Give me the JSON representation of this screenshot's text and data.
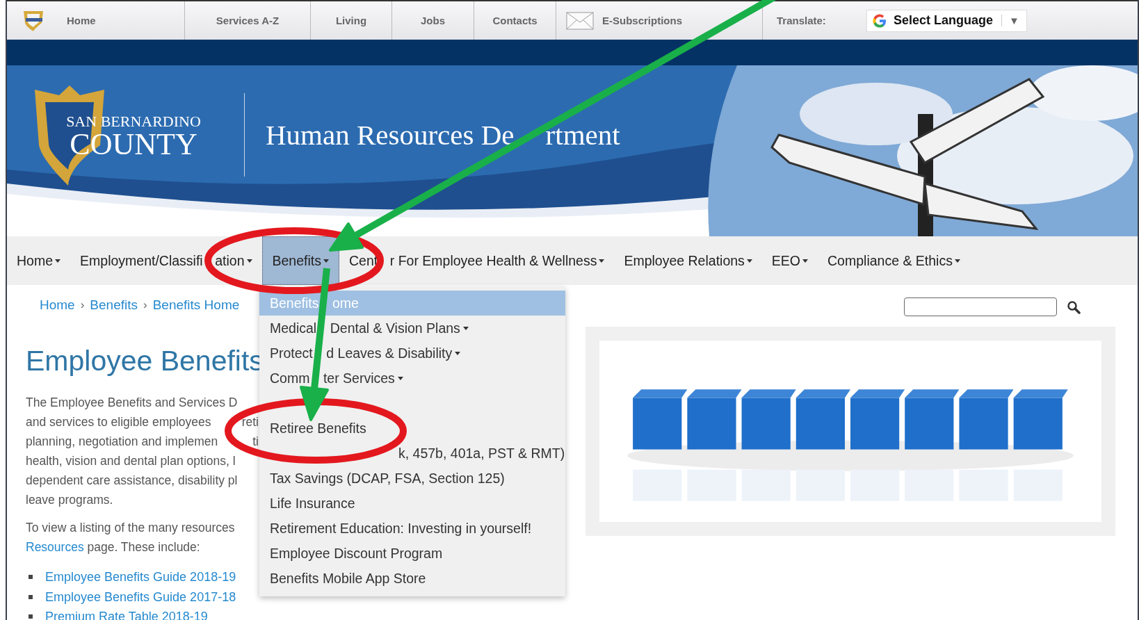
{
  "top_bar": {
    "links": [
      "Home",
      "Services A-Z",
      "Living",
      "Jobs",
      "Contacts"
    ],
    "subscriptions": "E-Subscriptions",
    "translate_label": "Translate:",
    "language_select": "Select Language",
    "select_arrow": "▼"
  },
  "banner": {
    "logo_line1": "SAN BERNARDINO",
    "logo_line2": "COUNTY",
    "title_parts": [
      "Human Resources De",
      "rtment"
    ]
  },
  "main_nav": [
    {
      "label_parts": [
        "Home"
      ],
      "selected": false
    },
    {
      "label_parts": [
        "Employment/Classifi",
        "ation"
      ],
      "selected": false
    },
    {
      "label_parts": [
        "Benefits"
      ],
      "selected": true
    },
    {
      "label_parts": [
        "Cent",
        "r For Employee Health & Wellness"
      ],
      "selected": false
    },
    {
      "label_parts": [
        "Employee Relations"
      ],
      "selected": false
    },
    {
      "label_parts": [
        "EEO"
      ],
      "selected": false
    },
    {
      "label_parts": [
        "Compliance & Ethics"
      ],
      "selected": false
    }
  ],
  "breadcrumb": {
    "items": [
      "Home",
      "Benefits",
      "Benefits Home"
    ],
    "separator": "›"
  },
  "dropdown": [
    {
      "label_parts": [
        "Benefits",
        "ome"
      ],
      "selected": true,
      "submenu": false
    },
    {
      "label_parts": [
        "Medical",
        "Dental & Vision Plans"
      ],
      "selected": false,
      "submenu": true
    },
    {
      "label_parts": [
        "Protect",
        "d Leaves & Disability"
      ],
      "selected": false,
      "submenu": true
    },
    {
      "label_parts": [
        "Comm",
        "ter Services"
      ],
      "selected": false,
      "submenu": true
    },
    {
      "selected": false,
      "submenu": false
    },
    {
      "label_parts": [
        "Retiree Benefits"
      ],
      "selected": false,
      "submenu": false
    },
    {
      "label_parts": [
        "k, 457b, 401a, PST & RMT)"
      ],
      "selected": false,
      "submenu": false,
      "kind": "start_hidden"
    },
    {
      "label_parts": [
        "Tax Savings (DCAP, FSA, Section 125)"
      ],
      "selected": false,
      "submenu": false
    },
    {
      "label_parts": [
        "Life Insurance"
      ],
      "selected": false,
      "submenu": false
    },
    {
      "label_parts": [
        "Retirement Education: Investing in yourself!"
      ],
      "selected": false,
      "submenu": false
    },
    {
      "label_parts": [
        "Employee Discount Program"
      ],
      "selected": false,
      "submenu": false
    },
    {
      "label_parts": [
        "Benefits Mobile App Store"
      ],
      "selected": false,
      "submenu": false
    }
  ],
  "content": {
    "heading": "Employee Benefits",
    "paragraph_lines": [
      [
        "The Employee Benefits and Services D"
      ],
      [
        "and services to eligible employees",
        "reti"
      ],
      [
        "planning, negotiation and implemen",
        "ti"
      ],
      [
        "health, vision and dental plan options, l"
      ],
      [
        "dependent care assistance, disability pl"
      ],
      [
        "leave programs."
      ]
    ],
    "listing_line": "To view a listing of the many resources",
    "resources_link": "Resources",
    "listing_rest": "page. These include:",
    "links": [
      "Employee Benefits Guide 2018-19",
      "Employee Benefits Guide 2017-18",
      "Premium Rate Table 2018-19"
    ]
  },
  "search": {
    "kind": "field"
  }
}
